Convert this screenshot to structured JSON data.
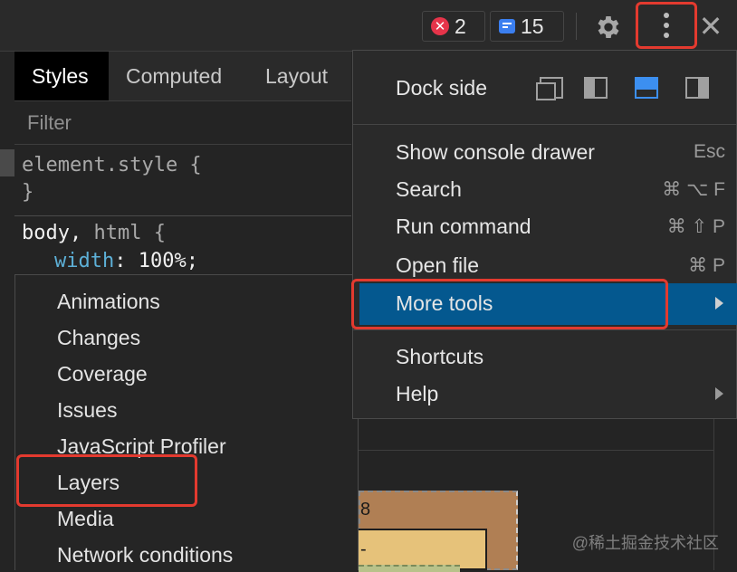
{
  "topbar": {
    "error_count": "2",
    "message_count": "15"
  },
  "tabs": [
    {
      "label": "Styles",
      "active": true
    },
    {
      "label": "Computed",
      "active": false
    },
    {
      "label": "Layout",
      "active": false
    }
  ],
  "filter": {
    "placeholder": "Filter"
  },
  "styles_code": {
    "block1_line1": "element.style {",
    "block1_line2": "}",
    "block2_selector": "body, ",
    "block2_selector2": "html {",
    "block2_prop": "width",
    "block2_colon": ": ",
    "block2_value": "100%;"
  },
  "more_tools_submenu": [
    "Animations",
    "Changes",
    "Coverage",
    "Issues",
    "JavaScript Profiler",
    "Layers",
    "Media",
    "Network conditions"
  ],
  "main_menu": {
    "dock_side_label": "Dock side",
    "dock_options": [
      {
        "icon": "undock-icon",
        "active": false
      },
      {
        "icon": "dock-left-icon",
        "active": false
      },
      {
        "icon": "dock-bottom-icon",
        "active": true
      },
      {
        "icon": "dock-right-icon",
        "active": false
      }
    ],
    "items": [
      {
        "label": "Show console drawer",
        "shortcut": "Esc"
      },
      {
        "label": "Search",
        "shortcut": "⌘ ⌥ F"
      },
      {
        "label": "Run command",
        "shortcut": "⌘ ⇧ P"
      },
      {
        "label": "Open file",
        "shortcut": "⌘ P"
      },
      {
        "label": "More tools",
        "submenu": true,
        "highlighted": true
      },
      {
        "label": "Shortcuts"
      },
      {
        "label": "Help",
        "submenu": true
      }
    ]
  },
  "box_model": {
    "margin_value": "8",
    "dash": "-"
  },
  "watermark": "@稀土掘金技术社区",
  "colors": {
    "highlight": "#04588f",
    "annotation_red": "#e33a2f",
    "accent_blue": "#3c8ff0",
    "error_red": "#e6344a"
  }
}
